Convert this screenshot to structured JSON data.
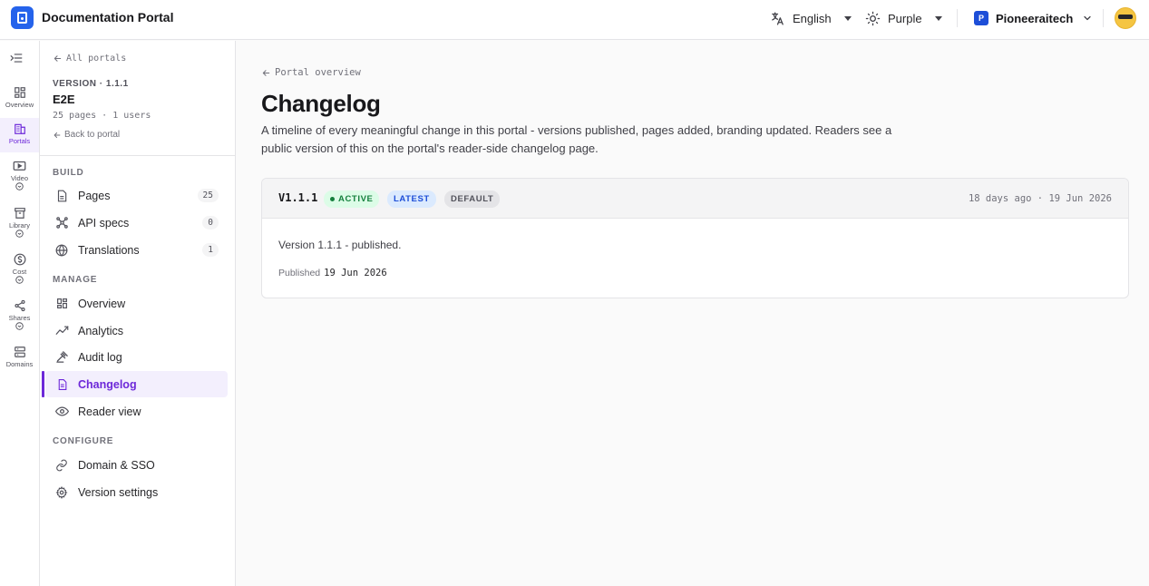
{
  "app": {
    "title": "Documentation Portal"
  },
  "topbar": {
    "language": "English",
    "theme": "Purple",
    "org_initial": "P",
    "org_name": "Pioneeraitech"
  },
  "rail": {
    "items": [
      {
        "label": "Overview",
        "icon": "overview-icon"
      },
      {
        "label": "Portals",
        "icon": "building-icon",
        "active": true
      },
      {
        "label": "Video",
        "icon": "video-icon"
      },
      {
        "label": "Library",
        "icon": "archive-icon"
      },
      {
        "label": "Cost",
        "icon": "dollar-icon"
      },
      {
        "label": "Shares",
        "icon": "share-icon"
      },
      {
        "label": "Domains",
        "icon": "server-icon"
      }
    ]
  },
  "sidebar": {
    "back_all": "All portals",
    "version": "VERSION · 1.1.1",
    "name": "E2E",
    "meta": "25 pages · 1 users",
    "back_portal": "Back to portal",
    "sections": {
      "build": "BUILD",
      "manage": "MANAGE",
      "configure": "CONFIGURE"
    },
    "build_items": [
      {
        "label": "Pages",
        "count": "25"
      },
      {
        "label": "API specs",
        "count": "0"
      },
      {
        "label": "Translations",
        "count": "1"
      }
    ],
    "manage_items": [
      {
        "label": "Overview"
      },
      {
        "label": "Analytics"
      },
      {
        "label": "Audit log"
      },
      {
        "label": "Changelog",
        "active": true
      },
      {
        "label": "Reader view"
      }
    ],
    "configure_items": [
      {
        "label": "Domain & SSO"
      },
      {
        "label": "Version settings"
      }
    ]
  },
  "main": {
    "breadcrumb": "Portal overview",
    "title": "Changelog",
    "description": "A timeline of every meaningful change in this portal - versions published, pages added, branding updated. Readers see a public version of this on the portal's reader-side changelog page.",
    "entries": [
      {
        "version": "V1.1.1",
        "badges": {
          "active": "ACTIVE",
          "latest": "LATEST",
          "default": "DEFAULT"
        },
        "date": "18 days ago · 19 Jun 2026",
        "text": "Version 1.1.1 - published.",
        "published_label": "Published",
        "published_date": "19 Jun 2026"
      }
    ]
  },
  "colors": {
    "accent": "#6d28d9",
    "brand": "#2563eb",
    "active_green": "#15803d",
    "latest_blue": "#1d4ed8"
  }
}
